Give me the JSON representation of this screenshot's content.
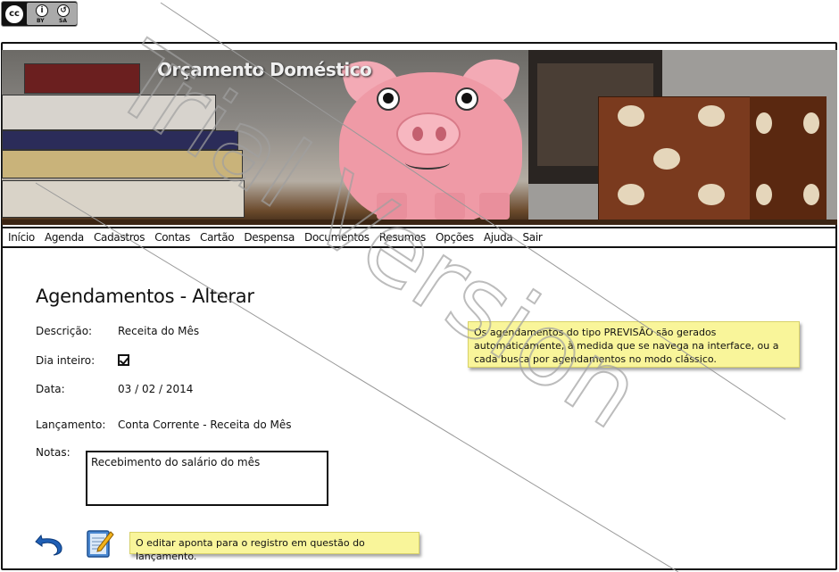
{
  "license_badge": {
    "by": "BY",
    "sa": "SA",
    "cc": "cc"
  },
  "banner": {
    "brand": "Orçamento Doméstico"
  },
  "menu": [
    "Início",
    "Agenda",
    "Cadastros",
    "Contas",
    "Cartão",
    "Despensa",
    "Documentos",
    "Resumos",
    "Opções",
    "Ajuda",
    "Sair"
  ],
  "page": {
    "title": "Agendamentos - Alterar"
  },
  "form": {
    "descricao_label": "Descrição:",
    "descricao_value": "Receita do Mês",
    "dia_inteiro_label": "Dia inteiro:",
    "dia_inteiro_checked": true,
    "data_label": "Data:",
    "data_value": "03 / 02 / 2014",
    "lancamento_label": "Lançamento:",
    "lancamento_value": "Conta Corrente - Receita do Mês",
    "notas_label": "Notas:",
    "notas_value": "Recebimento do salário do mês"
  },
  "notes": {
    "previsao": "Os agendamentos do tipo PREVISÃO são gerados automaticamente, à medida que se navega na interface, ou a cada busca por agendamentos no modo clássico.",
    "editar": "O editar aponta para o registro em questão do lançamento."
  },
  "actions": {
    "undo_icon": "undo-icon",
    "edit_icon": "edit-icon"
  },
  "watermark": "Trial Version",
  "colors": {
    "sticky": "#f9f59a",
    "frame": "#111111",
    "pig": "#ef9aa6"
  }
}
